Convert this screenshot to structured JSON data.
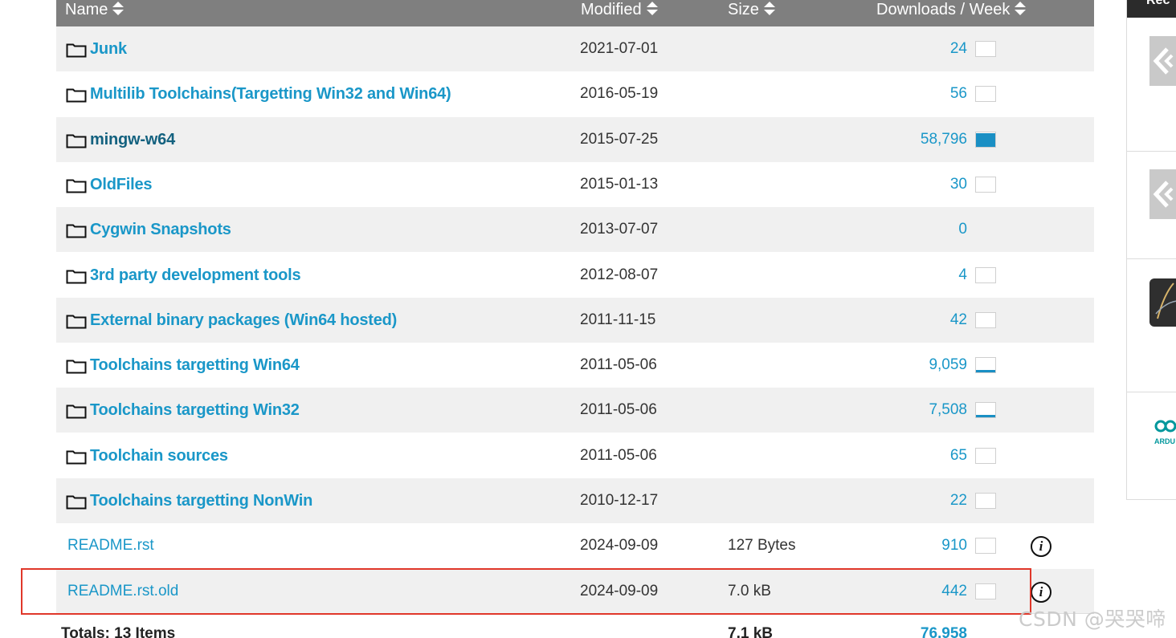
{
  "table": {
    "headers": {
      "name": "Name",
      "modified": "Modified",
      "size": "Size",
      "downloads": "Downloads / Week"
    },
    "rows": [
      {
        "type": "folder",
        "name": "Junk",
        "modified": "2021-07-01",
        "size": "",
        "downloads": "24",
        "trend_fill": 0
      },
      {
        "type": "folder",
        "name": "Multilib Toolchains(Targetting Win32 and Win64)",
        "modified": "2016-05-19",
        "size": "",
        "downloads": "56",
        "trend_fill": 0
      },
      {
        "type": "folder",
        "name": "mingw-w64",
        "modified": "2015-07-25",
        "size": "",
        "downloads": "58,796",
        "trend_fill": 0.85
      },
      {
        "type": "folder",
        "name": "OldFiles",
        "modified": "2015-01-13",
        "size": "",
        "downloads": "30",
        "trend_fill": 0
      },
      {
        "type": "folder",
        "name": "Cygwin Snapshots",
        "modified": "2013-07-07",
        "size": "",
        "downloads": "0",
        "trend_fill": null
      },
      {
        "type": "folder",
        "name": "3rd party development tools",
        "modified": "2012-08-07",
        "size": "",
        "downloads": "4",
        "trend_fill": 0
      },
      {
        "type": "folder",
        "name": "External binary packages (Win64 hosted)",
        "modified": "2011-11-15",
        "size": "",
        "downloads": "42",
        "trend_fill": 0
      },
      {
        "type": "folder",
        "name": "Toolchains targetting Win64",
        "modified": "2011-05-06",
        "size": "",
        "downloads": "9,059",
        "trend_fill": 0.1
      },
      {
        "type": "folder",
        "name": "Toolchains targetting Win32",
        "modified": "2011-05-06",
        "size": "",
        "downloads": "7,508",
        "trend_fill": 0.1
      },
      {
        "type": "folder",
        "name": "Toolchain sources",
        "modified": "2011-05-06",
        "size": "",
        "downloads": "65",
        "trend_fill": 0
      },
      {
        "type": "folder",
        "name": "Toolchains targetting NonWin",
        "modified": "2010-12-17",
        "size": "",
        "downloads": "22",
        "trend_fill": 0
      },
      {
        "type": "file",
        "name": "README.rst",
        "modified": "2024-09-09",
        "size": "127 Bytes",
        "downloads": "910",
        "trend_fill": 0
      },
      {
        "type": "file",
        "name": "README.rst.old",
        "modified": "2024-09-09",
        "size": "7.0 kB",
        "downloads": "442",
        "trend_fill": 0
      }
    ],
    "totals": {
      "label": "Totals: 13 Items",
      "size": "7.1 kB",
      "downloads": "76,958"
    }
  },
  "highlight_color": "#e0372a",
  "link_color": "#1a97c8",
  "header_bg": "#7f7f7f",
  "sidebar": {
    "top_text": "Rec",
    "logos": [
      "code-logo",
      "code-logo",
      "app-logo",
      "arduino-logo"
    ],
    "arduino_text": "ARDU"
  },
  "watermark": "CSDN @哭哭啼"
}
